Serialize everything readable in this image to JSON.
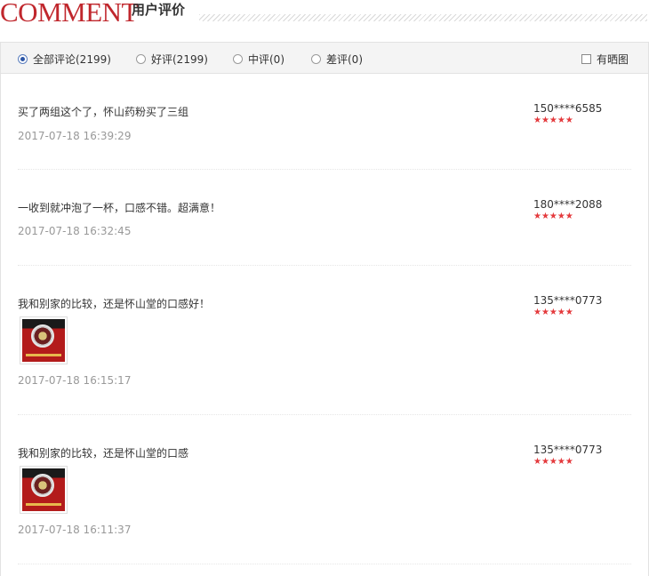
{
  "header": {
    "title_en": "COMMENT",
    "title_cn": "用户评价"
  },
  "filters": [
    {
      "label": "全部评论(2199)",
      "checked": true
    },
    {
      "label": "好评(2199)",
      "checked": false
    },
    {
      "label": "中评(0)",
      "checked": false
    },
    {
      "label": "差评(0)",
      "checked": false
    }
  ],
  "photo_filter": {
    "label": "有晒图",
    "checked": false
  },
  "reviews": [
    {
      "text": "买了两组这个了，怀山药粉买了三组",
      "date": "2017-07-18 16:39:29",
      "user": "150****6585",
      "stars": "★★★★★",
      "rating": 5,
      "has_image": false
    },
    {
      "text": "一收到就冲泡了一杯，口感不错。超满意！",
      "date": "2017-07-18 16:32:45",
      "user": "180****2088",
      "stars": "★★★★★",
      "rating": 5,
      "has_image": false
    },
    {
      "text": "我和别家的比较，还是怀山堂的口感好！",
      "date": "2017-07-18 16:15:17",
      "user": "135****0773",
      "stars": "★★★★★",
      "rating": 5,
      "has_image": true
    },
    {
      "text": "我和别家的比较，还是怀山堂的口感",
      "date": "2017-07-18 16:11:37",
      "user": "135****0773",
      "stars": "★★★★★",
      "rating": 5,
      "has_image": true
    }
  ],
  "colors": {
    "brand": "#c0272d",
    "star": "#e4393c",
    "date": "#999999"
  }
}
